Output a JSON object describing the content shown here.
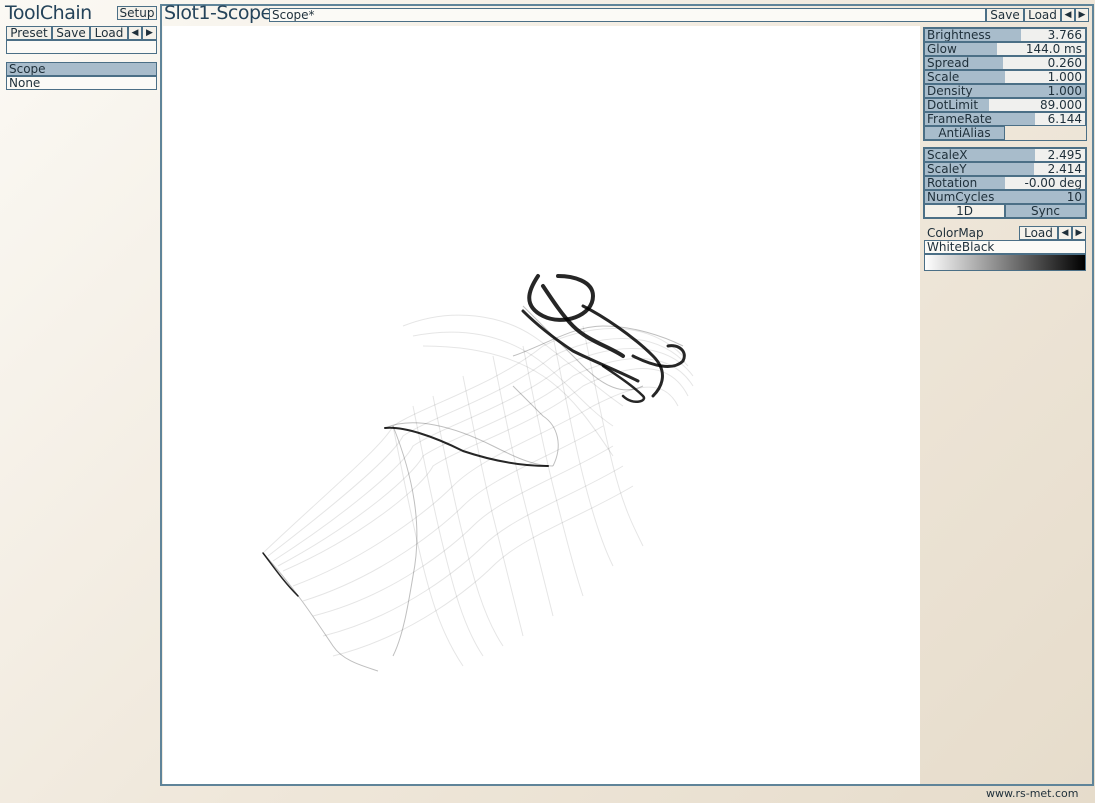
{
  "toolchain": {
    "title": "ToolChain",
    "setup_label": "Setup",
    "preset_label": "Preset",
    "save_label": "Save",
    "load_label": "Load",
    "prev_label": "◀",
    "next_label": "▶",
    "preset_value": "",
    "slots": [
      {
        "label": "Scope",
        "selected": true
      },
      {
        "label": "None",
        "selected": false
      }
    ]
  },
  "module": {
    "title": "Slot1-Scope",
    "preset_name": "Scope*",
    "save_label": "Save",
    "load_label": "Load",
    "prev_label": "◀",
    "next_label": "▶"
  },
  "params1": [
    {
      "label": "Brightness",
      "value": "3.766",
      "fraction": 0.6
    },
    {
      "label": "Glow",
      "value": "144.0 ms",
      "fraction": 0.45
    },
    {
      "label": "Spread",
      "value": "0.260",
      "fraction": 0.49
    },
    {
      "label": "Scale",
      "value": "1.000",
      "fraction": 0.5
    },
    {
      "label": "Density",
      "value": "1.000",
      "fraction": 1.0
    },
    {
      "label": "DotLimit",
      "value": "89.000",
      "fraction": 0.4
    },
    {
      "label": "FrameRate",
      "value": "6.144",
      "fraction": 0.69
    }
  ],
  "antialias_label": "AntiAlias",
  "params2": [
    {
      "label": "ScaleX",
      "value": "2.495",
      "fraction": 0.69
    },
    {
      "label": "ScaleY",
      "value": "2.414",
      "fraction": 0.68
    },
    {
      "label": "Rotation",
      "value": "-0.00 deg",
      "fraction": 0.5
    },
    {
      "label": "NumCycles",
      "value": "10",
      "fraction": 1.0
    }
  ],
  "oned_label": "1D",
  "sync_label": "Sync",
  "colormap": {
    "label": "ColorMap",
    "load_label": "Load",
    "prev_label": "◀",
    "next_label": "▶",
    "value": "WhiteBlack"
  },
  "footer": {
    "url": "www.rs-met.com"
  }
}
